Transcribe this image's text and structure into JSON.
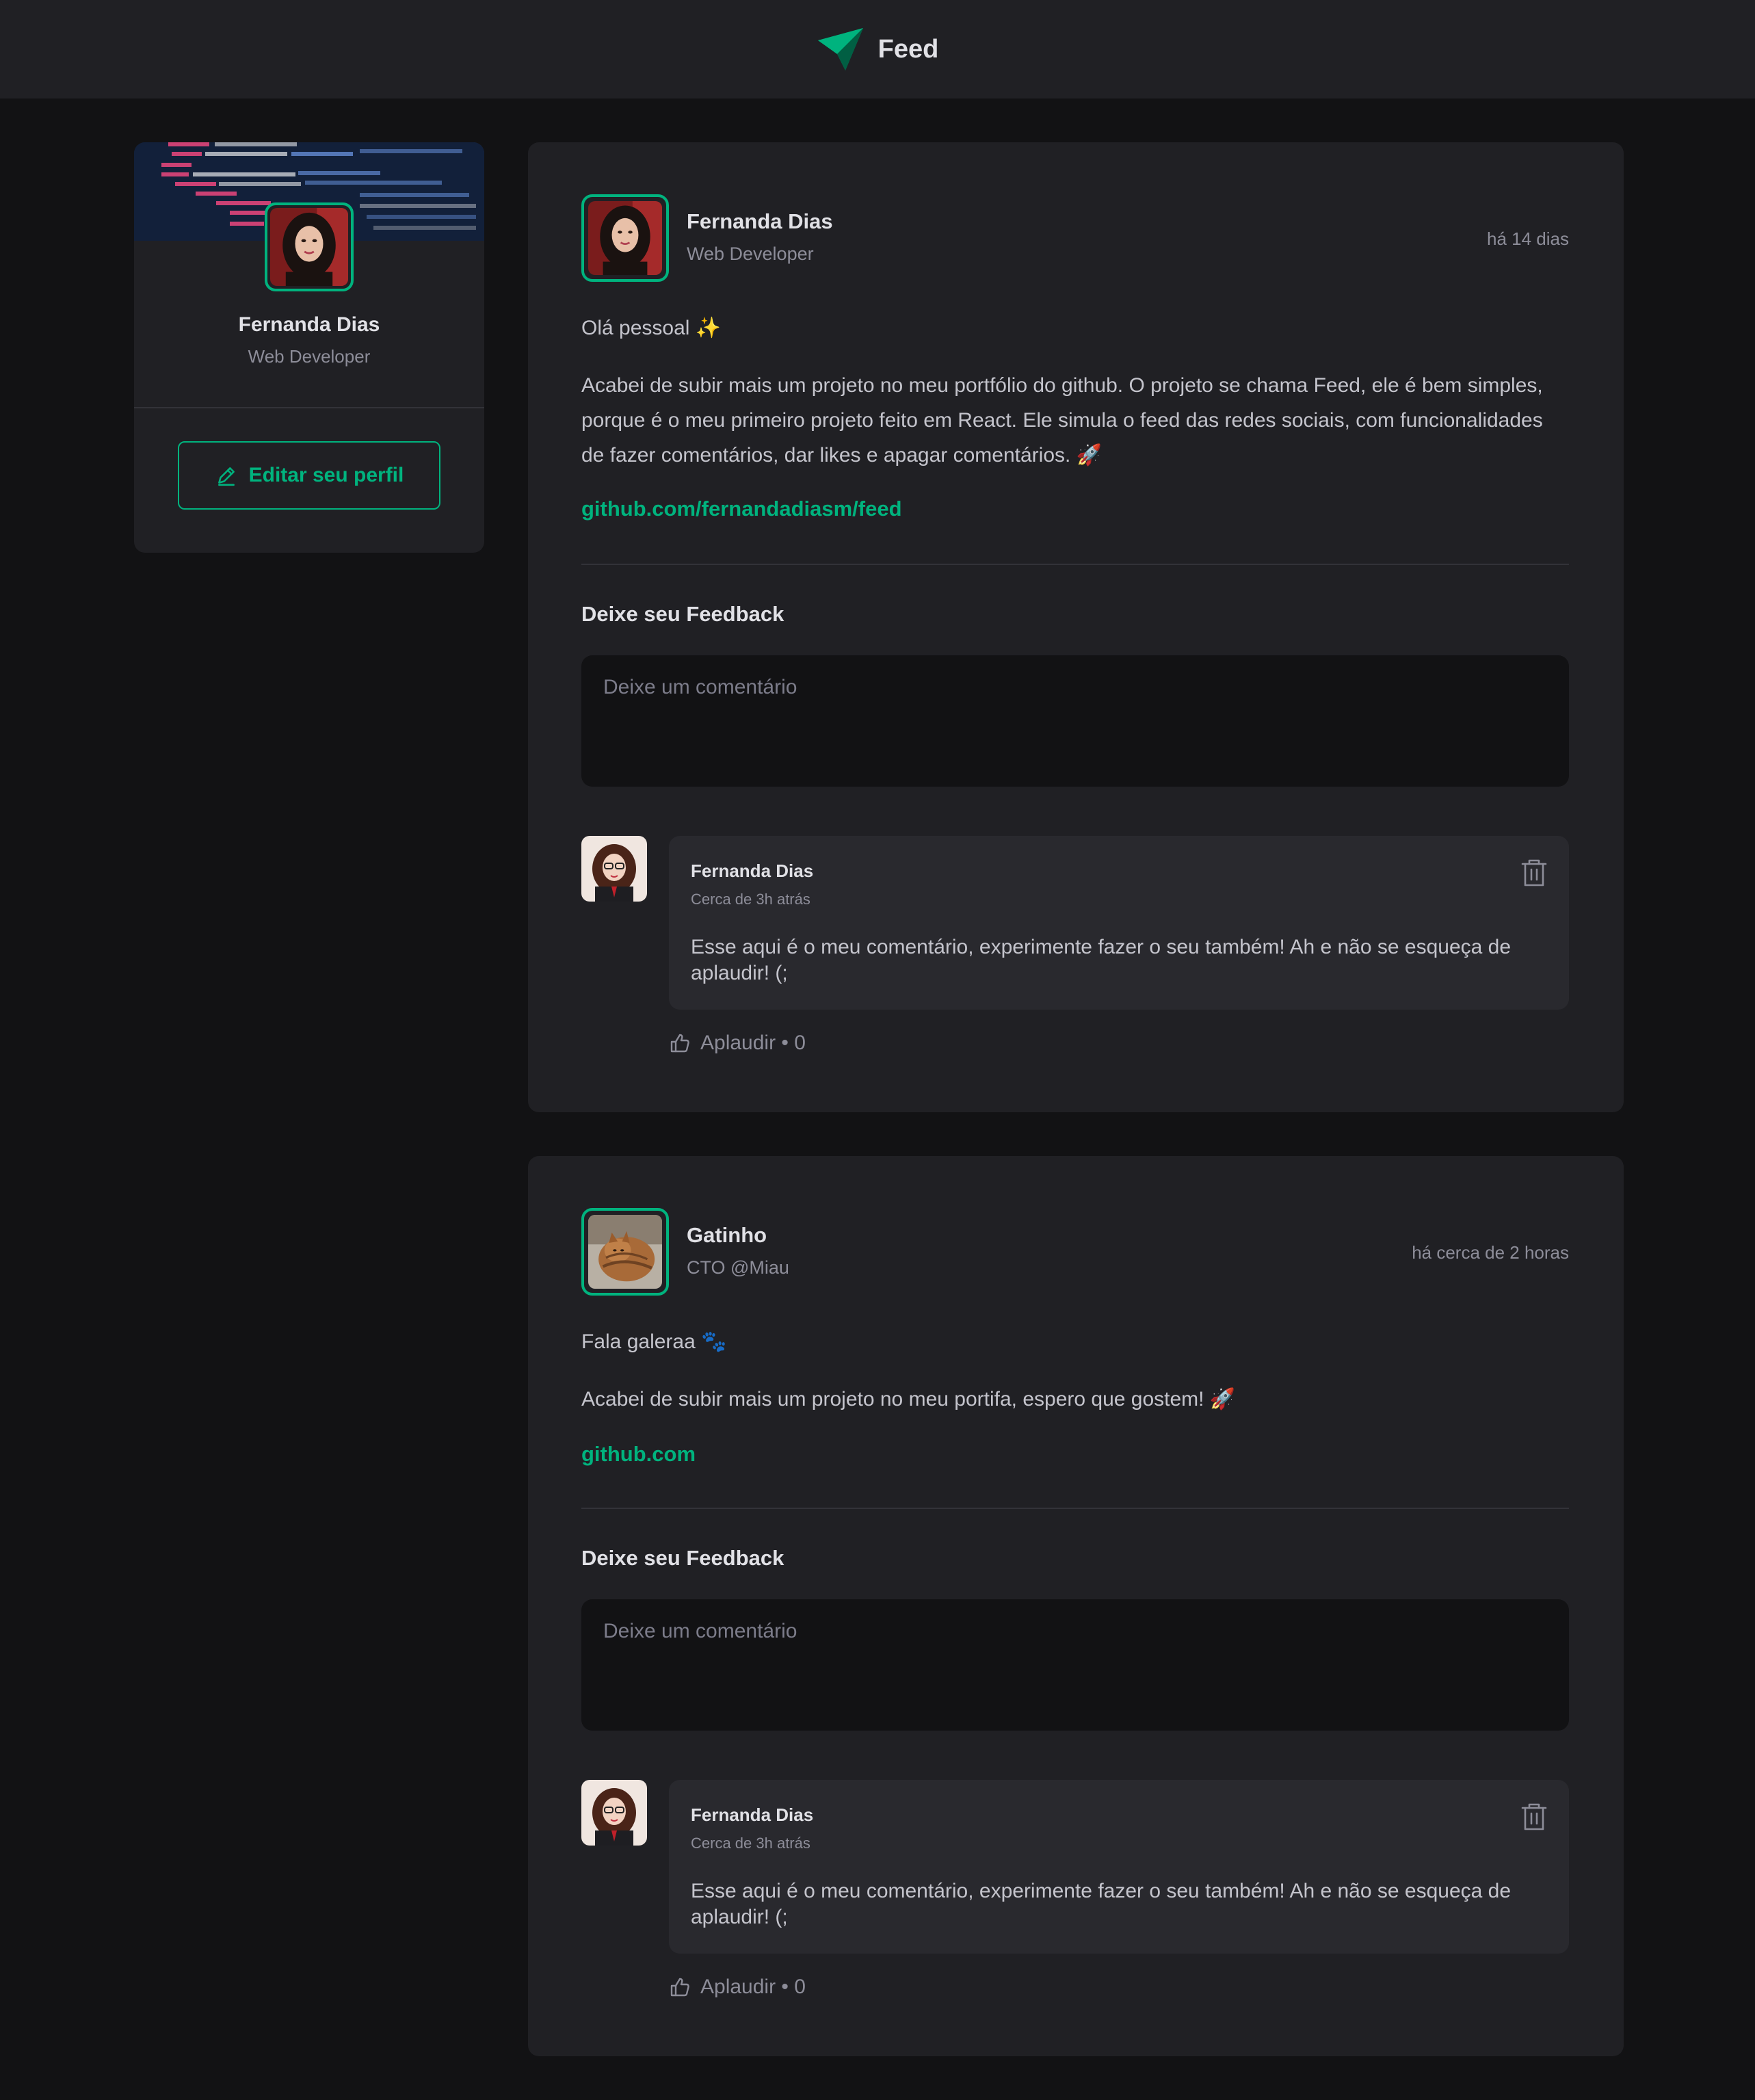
{
  "header": {
    "title": "Feed",
    "logo_icon": "feed-logo-icon",
    "accent": "#00b37e"
  },
  "sidebar": {
    "name": "Fernanda Dias",
    "role": "Web Developer",
    "edit_button_label": "Editar seu perfil",
    "edit_icon": "pencil-icon"
  },
  "posts": [
    {
      "author_name": "Fernanda Dias",
      "author_role": "Web Developer",
      "time": "há 14 dias",
      "greeting": "Olá pessoal ✨",
      "body": "Acabei de subir mais um projeto no meu portfólio do github. O projeto se chama Feed, ele é bem simples, porque é o meu primeiro projeto feito em React. Ele simula o feed das redes sociais, com funcionalidades de fazer comentários, dar likes e apagar comentários. 🚀",
      "link": "github.com/fernandadiasm/feed",
      "feedback_title": "Deixe seu Feedback",
      "comment_placeholder": "Deixe um comentário",
      "comment": {
        "author": "Fernanda Dias",
        "time": "Cerca de 3h atrás",
        "content": "Esse aqui é o meu comentário, experimente fazer o seu também! Ah e não se esqueça de aplaudir! (;",
        "applaud_label": "Aplaudir • 0"
      }
    },
    {
      "author_name": "Gatinho",
      "author_role": "CTO @Miau",
      "time": "há cerca de 2 horas",
      "greeting": "Fala galeraa 🐾",
      "body": "Acabei de subir mais um projeto no meu portifa, espero que gostem! 🚀",
      "link": "github.com",
      "feedback_title": "Deixe seu Feedback",
      "comment_placeholder": "Deixe um comentário",
      "comment": {
        "author": "Fernanda Dias",
        "time": "Cerca de 3h atrás",
        "content": "Esse aqui é o meu comentário, experimente fazer o seu também! Ah e não se esqueça de aplaudir! (;",
        "applaud_label": "Aplaudir • 0"
      }
    }
  ]
}
